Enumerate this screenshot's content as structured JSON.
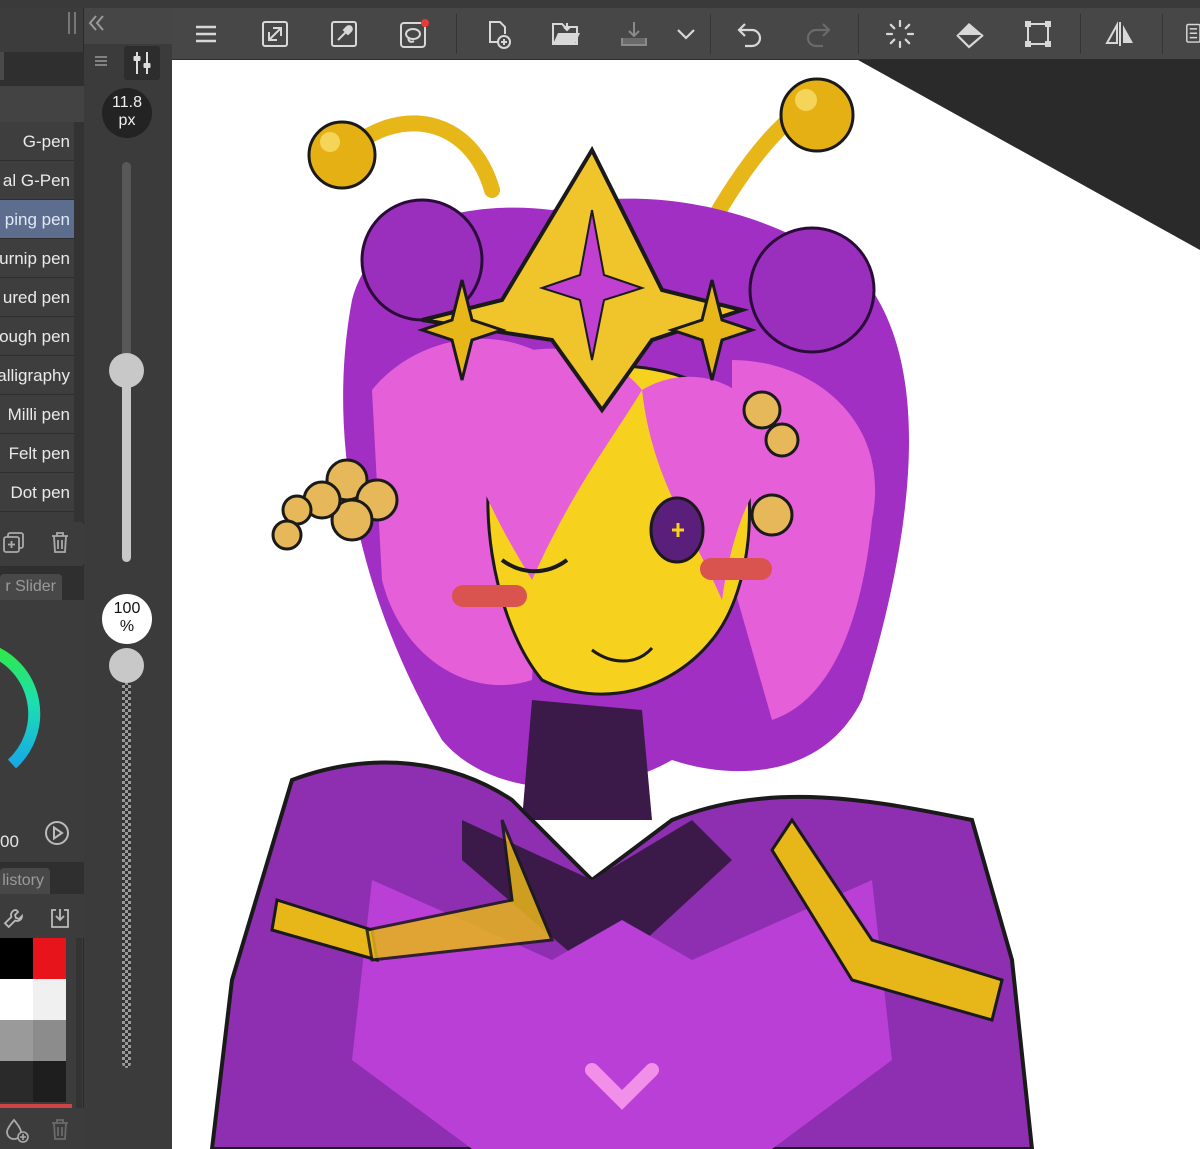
{
  "brush_tool": {
    "items": [
      {
        "label": "G-pen"
      },
      {
        "label": "al G-Pen"
      },
      {
        "label": "ping pen",
        "selected": true
      },
      {
        "label": "urnip pen"
      },
      {
        "label": "ured pen"
      },
      {
        "label": "ough pen"
      },
      {
        "label": "alligraphy"
      },
      {
        "label": "Milli pen"
      },
      {
        "label": "Felt pen"
      },
      {
        "label": "Dot pen"
      }
    ]
  },
  "color_panel": {
    "tab_label": "r Slider",
    "value_text": "00"
  },
  "history_panel": {
    "tab_label": "listory"
  },
  "sliders": {
    "size_value": "11.8",
    "size_unit": "px",
    "size_fraction": 0.48,
    "opacity_value": "100",
    "opacity_unit": "%",
    "opacity_fraction": 1.0
  },
  "swatches": [
    "#000000",
    "#e8141c",
    "#ffffff",
    "#f0f0f0",
    "#9a9a9a",
    "#8c8c8c",
    "#2a2a2a",
    "#1e1e1e"
  ],
  "colors": {
    "selected_item": "#5d6d8d",
    "canvas_bg": "#ffffff",
    "notification_dot": "#e83a3a"
  },
  "toolbar": {
    "icons": [
      "menu-icon",
      "fit-view-icon",
      "eyedropper-icon",
      "lasso-icon",
      "new-file-icon",
      "open-folder-icon",
      "save-download-icon",
      "dropdown-chevron-icon",
      "undo-icon",
      "redo-icon",
      "loading-spinner-icon",
      "fill-bucket-icon",
      "transform-icon",
      "flip-horizontal-icon"
    ]
  }
}
